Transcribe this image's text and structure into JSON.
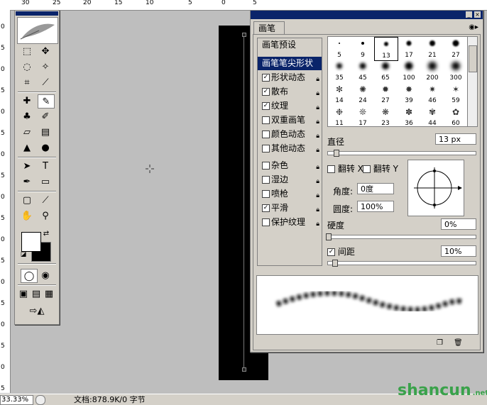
{
  "ruler_top": {
    "ticks": [
      "30",
      "25",
      "20",
      "15",
      "10",
      "5",
      "0",
      "5"
    ]
  },
  "ruler_left": {
    "ticks": [
      "0",
      "5",
      "0",
      "5",
      "0",
      "5",
      "0",
      "5",
      "0",
      "5",
      "0",
      "5",
      "0",
      "5",
      "0",
      "5",
      "0",
      "5"
    ]
  },
  "statusbar": {
    "zoom": "33.33%",
    "doc_info": "文档:878.9K/0 字节"
  },
  "brushes_panel": {
    "tab": "画笔",
    "menu_icon": "menu-arrow-icon",
    "list": [
      {
        "label": "画笔预设",
        "checkbox": false,
        "checked": false,
        "lock": false,
        "selected": false
      },
      {
        "label": "画笔笔尖形状",
        "checkbox": false,
        "checked": false,
        "lock": false,
        "selected": true
      },
      {
        "label": "形状动态",
        "checkbox": true,
        "checked": true,
        "lock": true,
        "selected": false
      },
      {
        "label": "散布",
        "checkbox": true,
        "checked": true,
        "lock": true,
        "selected": false
      },
      {
        "label": "纹理",
        "checkbox": true,
        "checked": true,
        "lock": true,
        "selected": false
      },
      {
        "label": "双重画笔",
        "checkbox": true,
        "checked": false,
        "lock": true,
        "selected": false
      },
      {
        "label": "颜色动态",
        "checkbox": true,
        "checked": false,
        "lock": true,
        "selected": false
      },
      {
        "label": "其他动态",
        "checkbox": true,
        "checked": false,
        "lock": true,
        "selected": false
      },
      {
        "label": "杂色",
        "checkbox": true,
        "checked": false,
        "lock": true,
        "selected": false
      },
      {
        "label": "湿边",
        "checkbox": true,
        "checked": false,
        "lock": true,
        "selected": false
      },
      {
        "label": "喷枪",
        "checkbox": true,
        "checked": false,
        "lock": true,
        "selected": false
      },
      {
        "label": "平滑",
        "checkbox": true,
        "checked": true,
        "lock": true,
        "selected": false
      },
      {
        "label": "保护纹理",
        "checkbox": true,
        "checked": false,
        "lock": true,
        "selected": false
      }
    ],
    "brush_sizes": [
      "5",
      "9",
      "13",
      "17",
      "21",
      "27",
      "35",
      "45",
      "65",
      "100",
      "200",
      "300",
      "14",
      "24",
      "27",
      "39",
      "46",
      "59",
      "11",
      "17",
      "23",
      "36",
      "44",
      "60"
    ],
    "selected_brush": "13",
    "diameter_label": "直径",
    "diameter_value": "13 px",
    "flip_x": "翻转 X",
    "flip_y": "翻转 Y",
    "angle_label": "角度:",
    "angle_value": "0度",
    "roundness_label": "圆度:",
    "roundness_value": "100%",
    "hardness_label": "硬度",
    "hardness_value": "0%",
    "spacing_label": "间距",
    "spacing_value": "10%",
    "spacing_checked": true
  },
  "watermark": {
    "text": "shancun",
    "sub": ".net"
  }
}
